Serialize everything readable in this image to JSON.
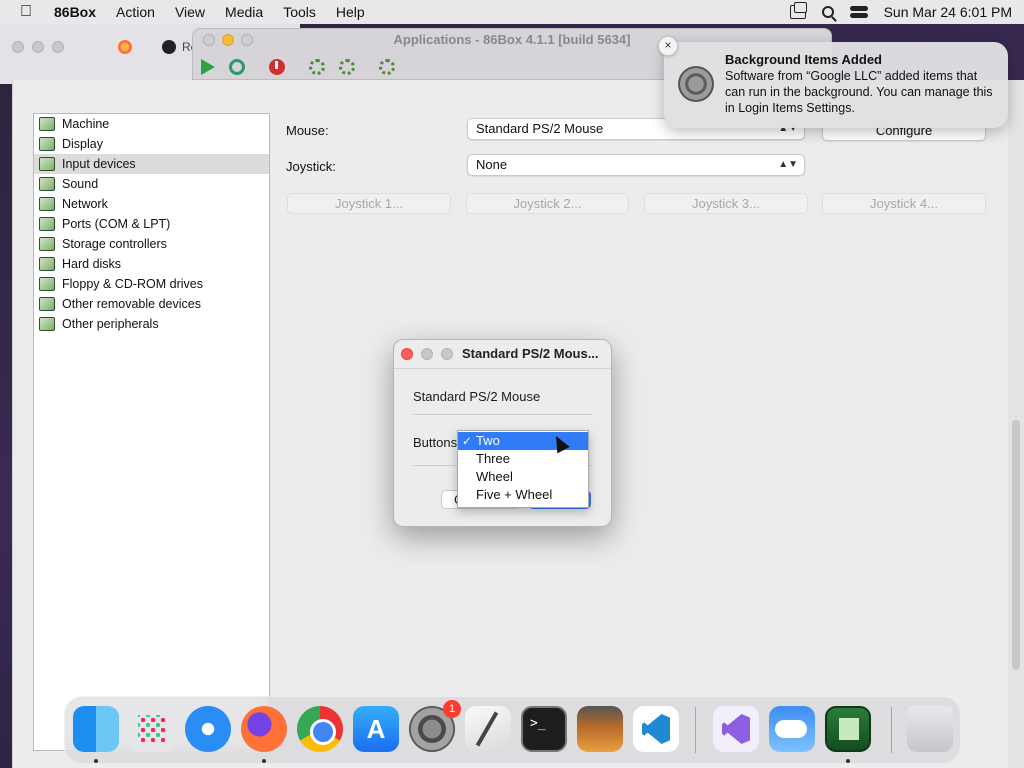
{
  "menubar": {
    "app_name": "86Box",
    "items": [
      "Action",
      "View",
      "Media",
      "Tools",
      "Help"
    ],
    "clock": "Sun Mar 24  6:01 PM"
  },
  "browser": {
    "tab_text": "Re"
  },
  "emulator": {
    "title": "Applications - 86Box 4.1.1 [build 5634]"
  },
  "notification": {
    "title": "Background Items Added",
    "body": "Software from “Google LLC” added items that can run in the background. You can manage this in Login Items Settings.",
    "close": "×"
  },
  "settings": {
    "categories": [
      {
        "label": "Machine"
      },
      {
        "label": "Display"
      },
      {
        "label": "Input devices",
        "selected": true
      },
      {
        "label": "Sound"
      },
      {
        "label": "Network"
      },
      {
        "label": "Ports (COM & LPT)"
      },
      {
        "label": "Storage controllers"
      },
      {
        "label": "Hard disks"
      },
      {
        "label": "Floppy & CD-ROM drives"
      },
      {
        "label": "Other removable devices"
      },
      {
        "label": "Other peripherals"
      }
    ],
    "mouse_label": "Mouse:",
    "mouse_value": "Standard PS/2 Mouse",
    "configure_label": "Configure",
    "joystick_label": "Joystick:",
    "joystick_value": "None",
    "joystick_buttons": [
      "Joystick 1...",
      "Joystick 2...",
      "Joystick 3...",
      "Joystick 4..."
    ]
  },
  "mouse_dialog": {
    "title": "Standard PS/2 Mous...",
    "device_name": "Standard PS/2 Mouse",
    "buttons_label": "Buttons",
    "cancel_fragment": "C",
    "options": [
      "Two",
      "Three",
      "Wheel",
      "Five + Wheel"
    ],
    "selected_option": "Two",
    "check": "✓"
  },
  "dock": {
    "settings_badge": "1"
  },
  "colors": {
    "accent": "#2f7cf6",
    "close_red": "#fe5f57",
    "badge_red": "#ff3b30"
  }
}
